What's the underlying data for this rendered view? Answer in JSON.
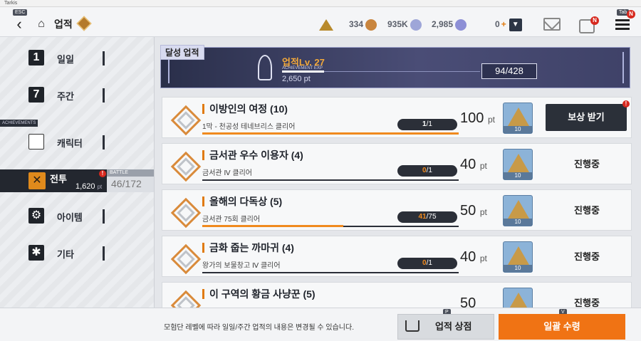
{
  "window": {
    "title": "Tarkis"
  },
  "header": {
    "esc_key": "ESC",
    "tab_key": "Tab",
    "title": "업적",
    "resources": {
      "gold": "334",
      "coins": "935K",
      "crystal": "2,985",
      "recharge": "0"
    },
    "notif": "N"
  },
  "sidebar": {
    "achievements_tag": "ACHIEVEMENTS",
    "items": [
      {
        "icon": "1",
        "label": "일일"
      },
      {
        "icon": "7",
        "label": "주간"
      },
      {
        "label": "캐릭터"
      },
      {
        "label": "전투",
        "points": "1,620",
        "unit": "pt",
        "alert": "!"
      },
      {
        "label": "아이템"
      },
      {
        "label": "기타"
      }
    ],
    "battle": {
      "caption": "BATTLE",
      "count": "46/172"
    }
  },
  "banner": {
    "section_label": "달성 업적",
    "level": "업적Lv. 27",
    "exp_label": "ACHIEVEMENT EXP",
    "points": "2,650 pt",
    "progress": "94/428",
    "progress_fraction": 0.22
  },
  "achievements": [
    {
      "title": "이방인의 여정 (10)",
      "desc": "1막 - 천공성 테네브리스 클리어",
      "cur": "1",
      "total": "/1",
      "fraction": 1.0,
      "pts": "100",
      "unit": "pt",
      "reward_qty": "10",
      "status": "보상 받기",
      "claimable": true
    },
    {
      "title": "금서관 우수 이용자 (4)",
      "desc": "금서관 Ⅳ 클리어",
      "cur": "0",
      "total": "/1",
      "fraction": 0.0,
      "pts": "40",
      "unit": "pt",
      "reward_qty": "10",
      "status": "진행중",
      "claimable": false
    },
    {
      "title": "올해의 다독상 (5)",
      "desc": "금서관 75회 클리어",
      "cur": "41",
      "total": "/75",
      "fraction": 0.55,
      "pts": "50",
      "unit": "pt",
      "reward_qty": "10",
      "status": "진행중",
      "claimable": false
    },
    {
      "title": "금화 줍는 까마귀 (4)",
      "desc": "왕가의 보물창고 Ⅳ 클리어",
      "cur": "0",
      "total": "/1",
      "fraction": 0.0,
      "pts": "40",
      "unit": "pt",
      "reward_qty": "10",
      "status": "진행중",
      "claimable": false
    },
    {
      "title": "이 구역의 황금 사냥꾼 (5)",
      "desc": "",
      "cur": "",
      "total": "",
      "fraction": 0.0,
      "pts": "50",
      "unit": "",
      "reward_qty": "",
      "status": "진행중",
      "claimable": false
    }
  ],
  "footer": {
    "note": "모험단 레벨에 따라 일일/주간 업적의 내용은 변경될 수 있습니다.",
    "shop_key": "P",
    "shop_label": "업적 상점",
    "claim_all_key": "V",
    "claim_all_label": "일괄 수령"
  },
  "colors": {
    "accent": "#f07314",
    "dark": "#2b2f38",
    "banner": "#3f4268"
  }
}
